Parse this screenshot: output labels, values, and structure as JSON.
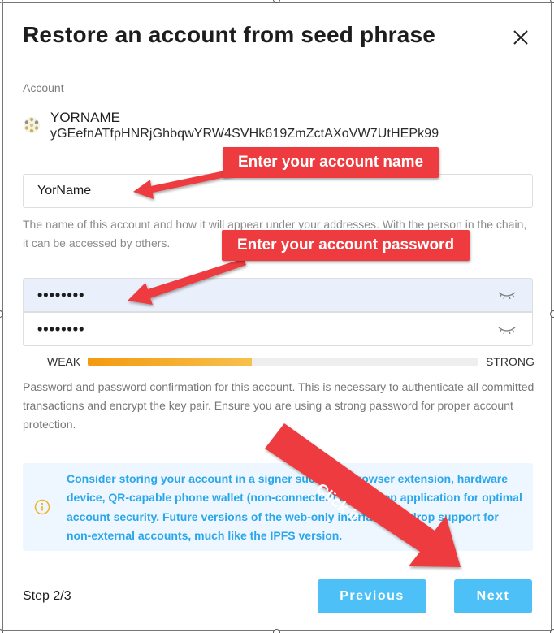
{
  "dialog": {
    "title": "Restore an account from seed phrase",
    "close_icon": "close-icon"
  },
  "account": {
    "section_label": "Account",
    "name": "YORNAME",
    "address": "yGEefnATfpHNRjGhbqwYRW4SVHk619ZmZctAXoVW7UtHEPk99",
    "identicon": "identicon"
  },
  "name_field": {
    "value": "YorName",
    "help": "The name of this account and how it will appear under your addresses. With the person in the chain, it can be accessed by others."
  },
  "password_field": {
    "value": "••••••••",
    "eye_icon": "eye-closed-icon"
  },
  "password_confirm_field": {
    "value": "••••••••",
    "eye_icon": "eye-closed-icon"
  },
  "strength": {
    "weak_label": "WEAK",
    "strong_label": "STRONG",
    "level": 0.42,
    "colors": [
      "#f39a0f",
      "#f7c04d"
    ]
  },
  "password_help": "Password and password confirmation for this account. This is necessary to authenticate all committed transactions and encrypt the key pair. Ensure you are using a strong password for proper account protection.",
  "notice": {
    "icon": "info-icon",
    "text": "Consider storing your account in a signer such as a browser extension, hardware device, QR-capable phone wallet (non-connected) or desktop application for optimal account security. Future versions of the web-only interface will drop support for non-external accounts, much like the IPFS version."
  },
  "footer": {
    "step": "Step 2/3",
    "previous_label": "Previous",
    "next_label": "Next"
  },
  "annotations": {
    "name_hint": "Enter your account name",
    "password_hint": "Enter your account password",
    "click_hint": "Click it",
    "color": "#ee3b3f"
  },
  "colors": {
    "accent": "#4cc0f7",
    "notice_bg": "#eef7ff",
    "notice_text": "#2aa7ea",
    "password_bg": "#e9effb"
  }
}
